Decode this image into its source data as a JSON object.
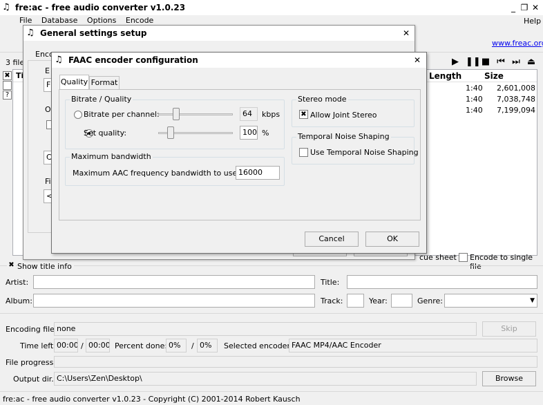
{
  "main": {
    "title": "fre:ac - free audio converter v1.0.23",
    "menu": [
      "File",
      "Database",
      "Options",
      "Encode"
    ],
    "help": "Help",
    "link": "www.freac.org",
    "file_count": "3 file(",
    "columns": {
      "title": "Tit",
      "length": "Length",
      "size": "Size"
    },
    "rows": [
      {
        "length": "1:40",
        "size": "2,601,008"
      },
      {
        "length": "1:40",
        "size": "7,038,748"
      },
      {
        "length": "1:40",
        "size": "7,199,094"
      }
    ],
    "cue_sheet": "cue sheet",
    "encode_single": "Encode to single file",
    "show_title_info": "Show title info",
    "labels": {
      "artist": "Artist:",
      "title": "Title:",
      "album": "Album:",
      "track": "Track:",
      "year": "Year:",
      "genre": "Genre:",
      "encoding_file": "Encoding file:",
      "time_left": "Time left:",
      "percent_done": "Percent done:",
      "selected_encoder": "Selected encoder:",
      "file_progress": "File progress:",
      "output_dir": "Output dir.:"
    },
    "values": {
      "encoding_file": "none",
      "time_left_1": "00:00",
      "time_left_2": "00:00",
      "percent_1": "0%",
      "percent_2": "0%",
      "encoder": "FAAC MP4/AAC Encoder",
      "output_dir": "C:\\Users\\Zen\\Desktop\\"
    },
    "skip": "Skip",
    "browse": "Browse",
    "status": "fre:ac - free audio converter v1.0.23 - Copyright (C) 2001-2014 Robert Kausch"
  },
  "general": {
    "title": "General settings setup",
    "tab_fragment": "Enco",
    "frag_1": "E",
    "frag_2": "F",
    "frag_3": "O",
    "frag_4": "C",
    "frag_5": "Fil",
    "frag_6": "<"
  },
  "faac": {
    "title": "FAAC encoder configuration",
    "tabs": [
      "Quality",
      "Format"
    ],
    "bitrate_group": "Bitrate / Quality",
    "bitrate_label": "Bitrate per channel:",
    "bitrate_value": "64",
    "bitrate_unit": "kbps",
    "quality_label": "Set quality:",
    "quality_value": "100",
    "quality_unit": "%",
    "bandwidth_group": "Maximum bandwidth",
    "bandwidth_label": "Maximum AAC frequency bandwidth to use (Hz):",
    "bandwidth_value": "16000",
    "stereo_group": "Stereo mode",
    "joint_stereo": "Allow Joint Stereo",
    "tns_group": "Temporal Noise Shaping",
    "tns_label": "Use Temporal Noise Shaping",
    "cancel": "Cancel",
    "ok": "OK"
  }
}
